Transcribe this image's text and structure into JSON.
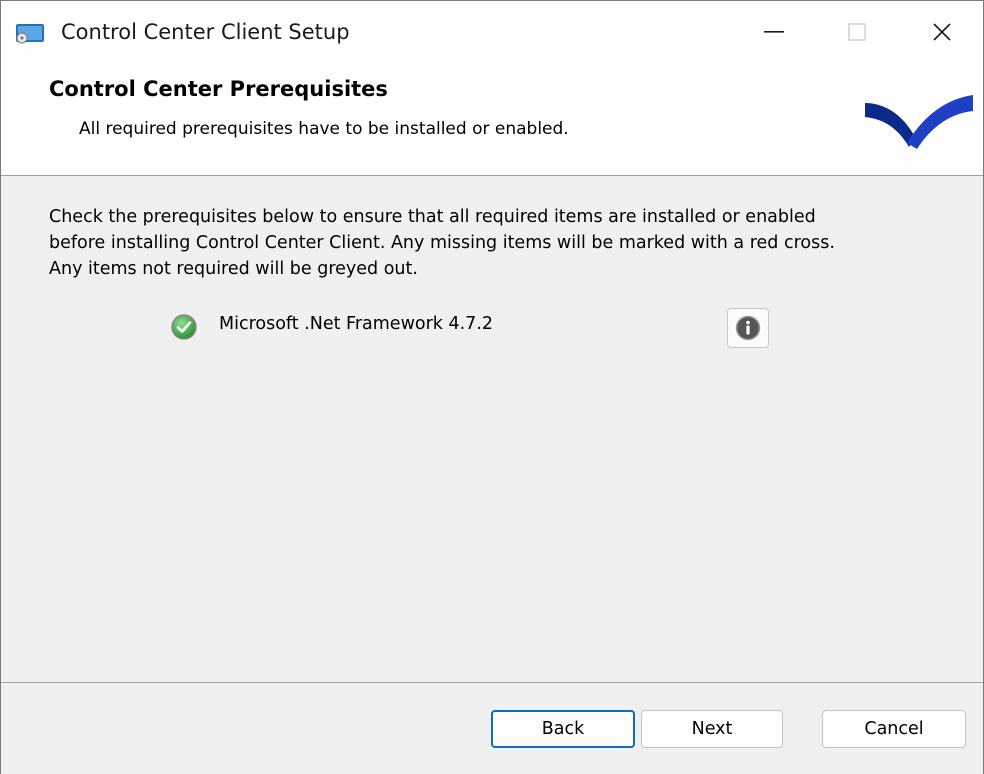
{
  "window": {
    "title": "Control Center Client Setup",
    "minimize_glyph": "—",
    "close_glyph": "✕"
  },
  "banner": {
    "title": "Control Center Prerequisites",
    "subtitle": "All required prerequisites have to be installed or enabled."
  },
  "content": {
    "description": "Check the prerequisites below to ensure that all required items are installed or enabled\nbefore installing Control Center Client.  Any missing items will be marked with a red cross.\nAny items not required will be greyed out.",
    "prerequisites": [
      {
        "label": "Microsoft .Net Framework 4.7.2",
        "status": "installed",
        "status_icon": "check-circle-icon",
        "info_icon": "info-icon"
      }
    ]
  },
  "buttons": {
    "back": "Back",
    "next": "Next",
    "cancel": "Cancel"
  },
  "colors": {
    "accent": "#0f6cbd",
    "logo_blue": "#1f3fc4",
    "logo_dark": "#0d2a8a",
    "check_green": "#3aa83a"
  }
}
